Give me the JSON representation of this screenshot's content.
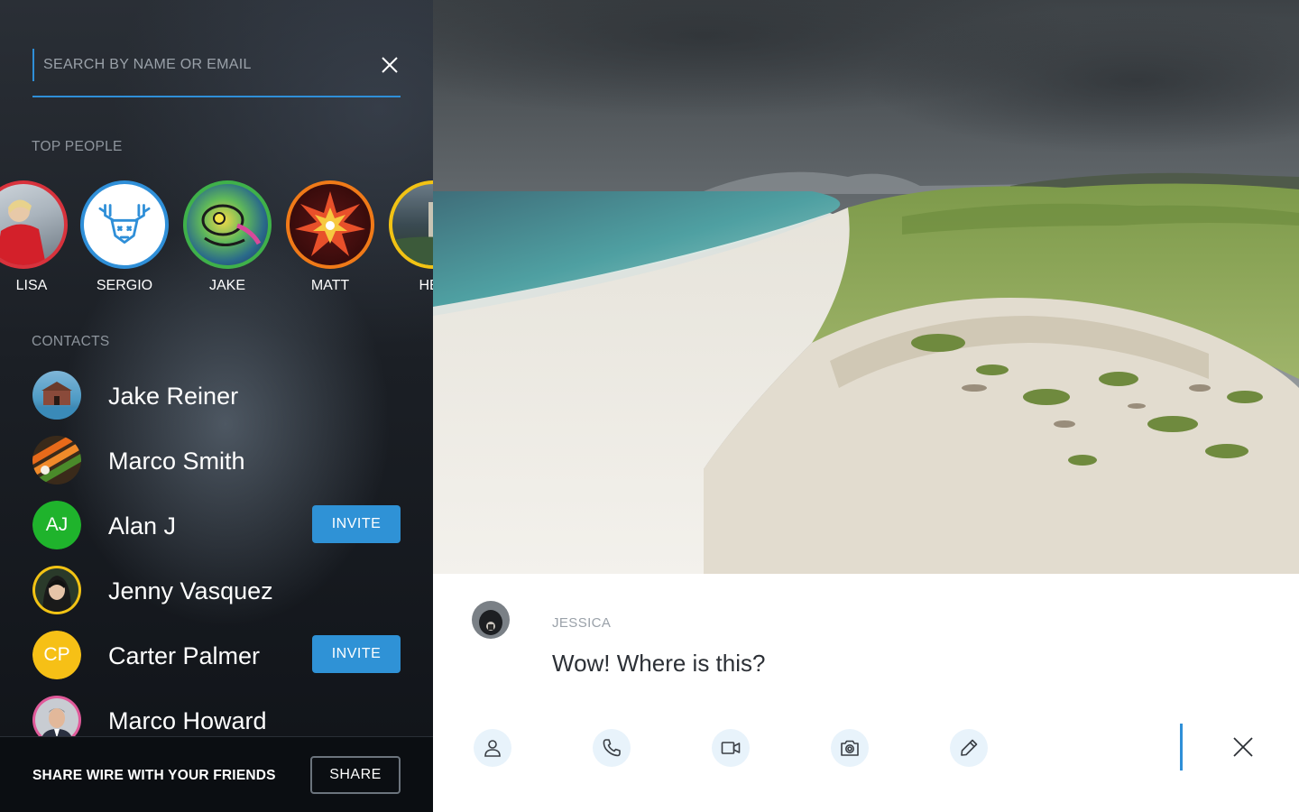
{
  "search": {
    "placeholder": "SEARCH BY NAME OR EMAIL",
    "clear_icon": "close-icon"
  },
  "top_people": {
    "label": "TOP PEOPLE",
    "people": [
      {
        "name": "LISA",
        "ring_color": "#d8323c"
      },
      {
        "name": "SERGIO",
        "ring_color": "#2f8fd8"
      },
      {
        "name": "JAKE",
        "ring_color": "#3fb14a"
      },
      {
        "name": "MATT",
        "ring_color": "#f07a18"
      },
      {
        "name": "HEL",
        "ring_color": "#f2c314"
      }
    ]
  },
  "contacts": {
    "label": "CONTACTS",
    "items": [
      {
        "name": "Jake Reiner"
      },
      {
        "name": "Marco Smith"
      },
      {
        "name": "Alan J",
        "initials": "AJ",
        "color": "#1fb32c",
        "action": "INVITE"
      },
      {
        "name": "Jenny Vasquez"
      },
      {
        "name": "Carter Palmer",
        "initials": "CP",
        "color": "#f6c016",
        "action": "INVITE"
      },
      {
        "name": "Marco Howard"
      }
    ]
  },
  "share": {
    "text": "SHARE WIRE WITH YOUR FRIENDS",
    "button": "SHARE"
  },
  "conversation": {
    "sender": "JESSICA",
    "message": "Wow! Where is this?"
  },
  "toolbar": {
    "icons": [
      "person-icon",
      "phone-icon",
      "video-camera-icon",
      "camera-icon",
      "pen-icon"
    ],
    "close_icon": "close-icon"
  },
  "colors": {
    "accent": "#2f8fd8",
    "invite": "#2f92d6",
    "tool_bg": "#e8f3fb"
  }
}
